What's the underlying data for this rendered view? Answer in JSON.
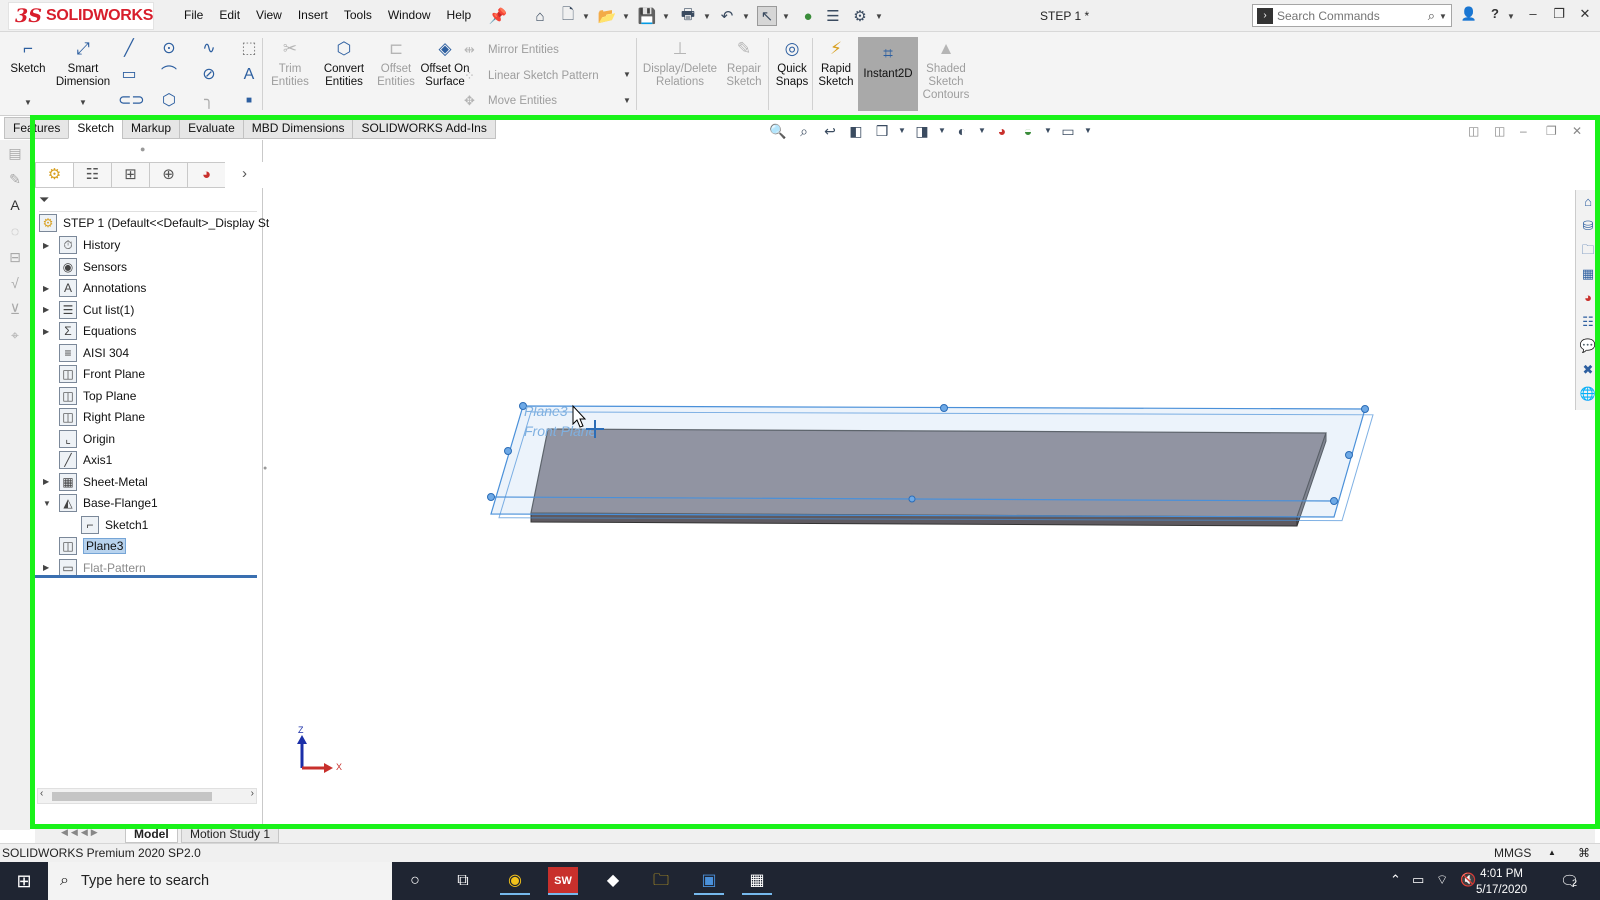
{
  "app": {
    "brand": "SOLIDWORKS",
    "document_title": "STEP 1 *",
    "menu": [
      "File",
      "Edit",
      "View",
      "Insert",
      "Tools",
      "Window",
      "Help"
    ],
    "search_placeholder": "Search Commands"
  },
  "ribbon": {
    "sketch": "Sketch",
    "smart_dimension": "Smart Dimension",
    "trim_entities": "Trim Entities",
    "convert_entities": "Convert Entities",
    "offset_entities": "Offset Entities",
    "offset_on_surface": "Offset On Surface",
    "mirror_entities": "Mirror Entities",
    "linear_sketch_pattern": "Linear Sketch Pattern",
    "move_entities": "Move Entities",
    "display_delete_relations": "Display/Delete Relations",
    "repair_sketch": "Repair Sketch",
    "quick_snaps": "Quick Snaps",
    "rapid_sketch": "Rapid Sketch",
    "instant2d": "Instant2D",
    "shaded_sketch_contours": "Shaded Sketch Contours"
  },
  "tabs": [
    "Features",
    "Sketch",
    "Markup",
    "Evaluate",
    "MBD Dimensions",
    "SOLIDWORKS Add-Ins"
  ],
  "active_tab": "Sketch",
  "feature_tree": {
    "root": "STEP 1  (Default<<Default>_Display St",
    "items": [
      {
        "label": "History",
        "expandable": true
      },
      {
        "label": "Sensors",
        "expandable": false
      },
      {
        "label": "Annotations",
        "expandable": true
      },
      {
        "label": "Cut list(1)",
        "expandable": true
      },
      {
        "label": "Equations",
        "expandable": true
      },
      {
        "label": "AISI 304",
        "expandable": false
      },
      {
        "label": "Front Plane",
        "expandable": false
      },
      {
        "label": "Top Plane",
        "expandable": false
      },
      {
        "label": "Right Plane",
        "expandable": false
      },
      {
        "label": "Origin",
        "expandable": false
      },
      {
        "label": "Axis1",
        "expandable": false
      },
      {
        "label": "Sheet-Metal",
        "expandable": true
      },
      {
        "label": "Base-Flange1",
        "expandable": true,
        "expanded": true
      },
      {
        "label": "Sketch1",
        "expandable": false
      },
      {
        "label": "Plane3",
        "expandable": false,
        "selected": true
      },
      {
        "label": "Flat-Pattern",
        "expandable": true,
        "suppressed": true
      }
    ]
  },
  "viewport": {
    "plane_label_1": "Plane3",
    "plane_label_2": "Front Plane",
    "triad_z": "Z",
    "triad_x": "X",
    "plane_color": "#4a90d9",
    "part_color": "#7f7b82"
  },
  "bottom_tabs": [
    "Model",
    "Motion Study 1"
  ],
  "status": {
    "product": "SOLIDWORKS Premium 2020 SP2.0",
    "units": "MMGS"
  },
  "taskbar": {
    "search_placeholder": "Type here to search",
    "time": "4:01 PM",
    "date": "5/17/2020",
    "notifications": "2"
  },
  "colors": {
    "accent_red": "#d81e2c",
    "frame_green": "#19f219",
    "selection_blue": "#b8d3ee"
  }
}
